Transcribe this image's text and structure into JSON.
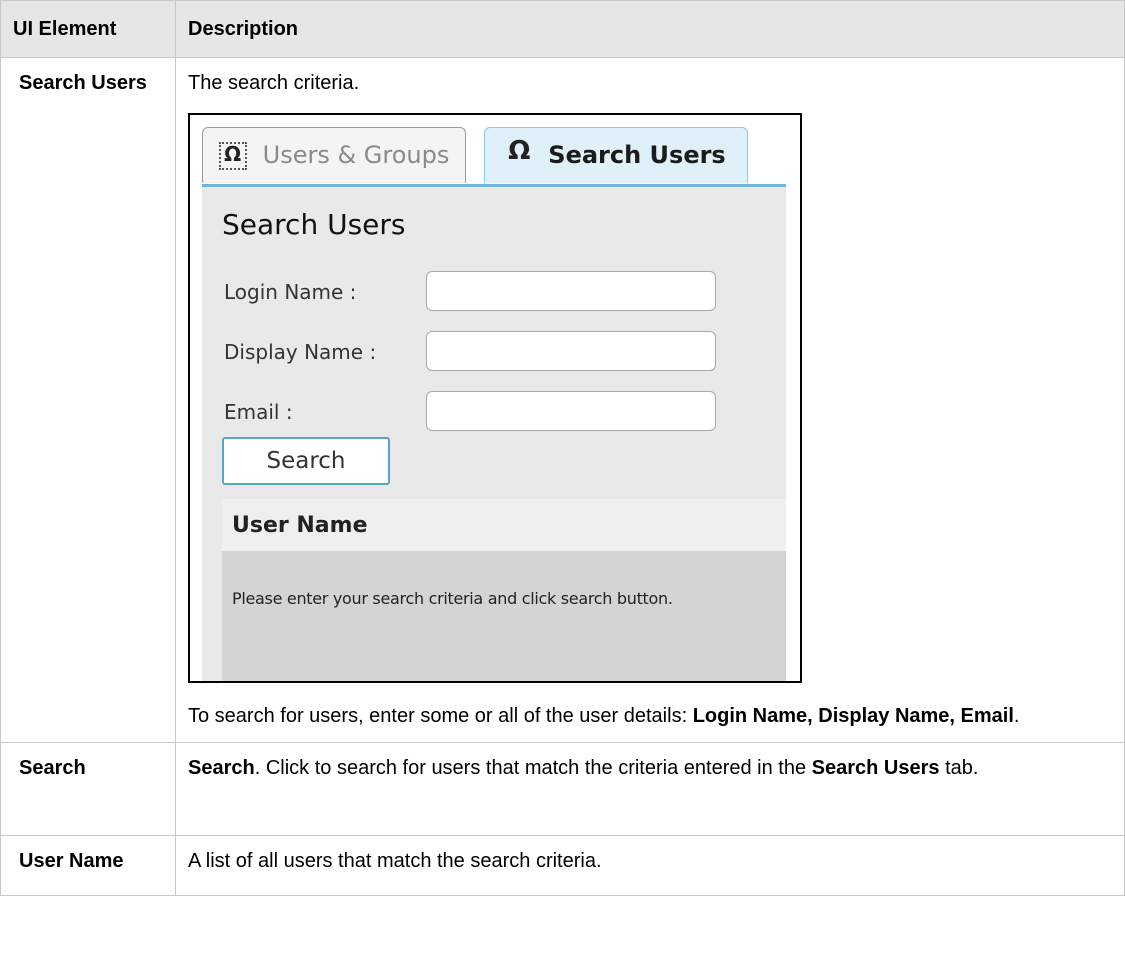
{
  "table": {
    "headers": [
      "UI Element",
      "Description"
    ],
    "rows": [
      {
        "element": "Search Users",
        "description": "The search criteria.",
        "after_prefix": "To search for users, enter some or all of the user details: ",
        "after_bold": "Login Name, Display Name, Email",
        "after_suffix": "."
      },
      {
        "element": "Search",
        "desc_bold_1": "Search",
        "desc_text_1": ". Click to search for users that match the criteria entered in the ",
        "desc_bold_2": "Search Users",
        "desc_text_2": " tab."
      },
      {
        "element": "User Name",
        "description": "A list of all users that match the search criteria."
      }
    ]
  },
  "screenshot": {
    "tabs": [
      {
        "label": "Users & Groups",
        "icon": "user-group-icon",
        "active": false
      },
      {
        "label": "Search Users",
        "icon": "user-icon",
        "active": true
      }
    ],
    "title": "Search Users",
    "fields": [
      {
        "label": "Login Name :",
        "value": ""
      },
      {
        "label": "Display Name :",
        "value": ""
      },
      {
        "label": "Email :",
        "value": ""
      }
    ],
    "search_button": "Search",
    "results_header": "User Name",
    "results_message": "Please enter your search criteria and click search button.",
    "colors": {
      "active_tab": "#dff0f8",
      "accent": "#5aa4c8"
    }
  }
}
